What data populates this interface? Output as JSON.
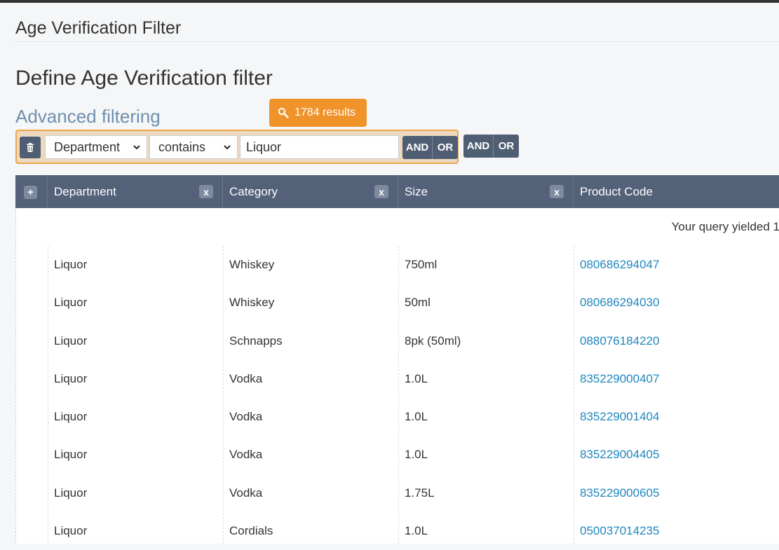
{
  "header": {
    "title": "Age Verification Filter"
  },
  "page": {
    "title": "Define Age Verification filter",
    "section": "Advanced filtering"
  },
  "results_badge": {
    "label": "1784 results"
  },
  "filter": {
    "field": "Department",
    "operator": "contains",
    "value": "Liquor",
    "and_label": "AND",
    "or_label": "OR"
  },
  "group_buttons": {
    "and_label": "AND",
    "or_label": "OR"
  },
  "table": {
    "add_label": "+",
    "remove_label": "x",
    "columns": [
      "Department",
      "Category",
      "Size",
      "Product Code"
    ],
    "query_message": "Your query yielded 1",
    "rows": [
      [
        "Liquor",
        "Whiskey",
        "750ml",
        "080686294047"
      ],
      [
        "Liquor",
        "Whiskey",
        "50ml",
        "080686294030"
      ],
      [
        "Liquor",
        "Schnapps",
        "8pk (50ml)",
        "088076184220"
      ],
      [
        "Liquor",
        "Vodka",
        "1.0L",
        "835229000407"
      ],
      [
        "Liquor",
        "Vodka",
        "1.0L",
        "835229001404"
      ],
      [
        "Liquor",
        "Vodka",
        "1.0L",
        "835229004405"
      ],
      [
        "Liquor",
        "Vodka",
        "1.75L",
        "835229000605"
      ],
      [
        "Liquor",
        "Cordials",
        "1.0L",
        "050037014235"
      ]
    ]
  },
  "colors": {
    "accent": "#f0932b",
    "header_bg": "#536179",
    "link": "#1f87c0"
  }
}
